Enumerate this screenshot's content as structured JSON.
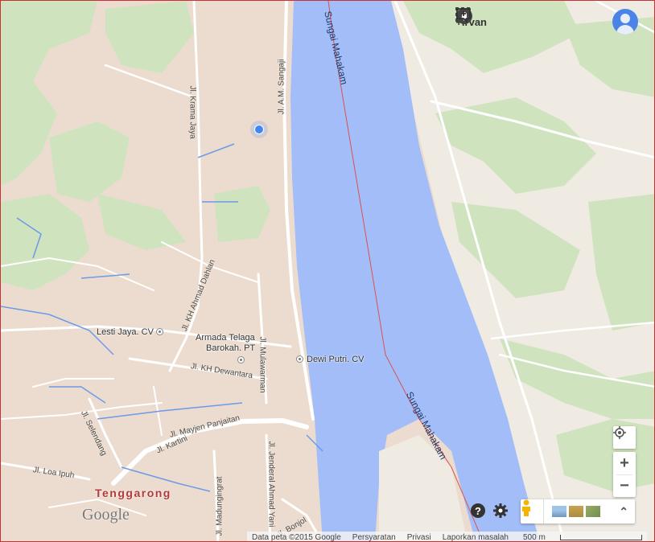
{
  "topbar": {
    "user_label": "+Irvan",
    "icons": [
      "apps-grid-icon",
      "notifications-bell-icon",
      "share-plus-icon",
      "account-avatar-icon"
    ]
  },
  "map": {
    "place_labels": {
      "city": "Tenggarong",
      "poi_lesti": "Lesti Jaya. CV",
      "poi_armada_1": "Armada Telaga",
      "poi_armada_2": "Barokah. PT",
      "poi_dewi": "Dewi Putri. CV"
    },
    "road_labels": {
      "krama_jaya": "Jl. Krama Jaya",
      "am_sangaji": "Jl. A.M. Sangaji",
      "kh_ahmad_dahlan": "Jl. KH Ahmad Dahlan",
      "kh_dewantara": "Jl. KH Dewantara",
      "mulawarman": "Jl. Mulawarman",
      "selendang": "Jl. Selendang",
      "mayjen_panjaitan": "Jl. Mayjen Panjaitan",
      "kartini": "Jl. Kartini",
      "loa_ipuh": "Jl. Loa Ipuh",
      "madungingrat": "Jl. Madungingrat",
      "jenderal_ahmad_yani": "Jl. Jenderal Ahmad Yani",
      "bonjol": "Jl. Bonjol"
    },
    "river_labels": {
      "upper": "Sungai Mahakam",
      "lower": "Sungai Mahakam"
    },
    "colors": {
      "river": "#a2bdf8",
      "land_urban": "#ecdccf",
      "land_open": "#efebe3",
      "forest": "#cfe3bf",
      "road": "#ffffff",
      "canal": "#6b9ae8",
      "boundary": "#d9534f",
      "location_dot": "#4285f4"
    }
  },
  "branding": {
    "logo_text": "Google"
  },
  "controls": {
    "zoom_in": "+",
    "zoom_out": "−",
    "expand": "⌃"
  },
  "footer": {
    "data": "Data peta ©2015 Google",
    "terms": "Persyaratan",
    "privacy": "Privasi",
    "report": "Laporkan masalah",
    "scale": "500 m"
  }
}
